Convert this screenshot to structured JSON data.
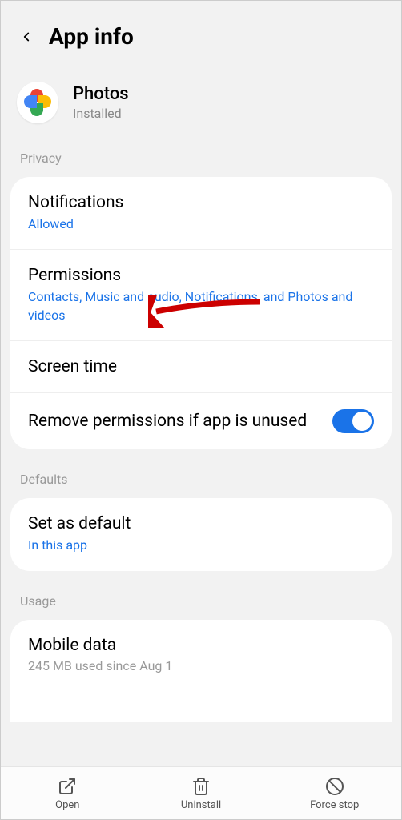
{
  "header": {
    "title": "App info"
  },
  "app": {
    "name": "Photos",
    "status": "Installed"
  },
  "sections": {
    "privacy_label": "Privacy",
    "defaults_label": "Defaults",
    "usage_label": "Usage"
  },
  "privacy": {
    "notifications": {
      "title": "Notifications",
      "sub": "Allowed"
    },
    "permissions": {
      "title": "Permissions",
      "sub": "Contacts, Music and audio, Notifications, and Photos and videos"
    },
    "screen_time": {
      "title": "Screen time"
    },
    "remove_unused": {
      "title": "Remove permissions if app is unused",
      "enabled": true
    }
  },
  "defaults": {
    "set_default": {
      "title": "Set as default",
      "sub": "In this app"
    }
  },
  "usage": {
    "mobile_data": {
      "title": "Mobile data",
      "sub": "245 MB used since Aug 1"
    }
  },
  "bottom": {
    "open": "Open",
    "uninstall": "Uninstall",
    "force_stop": "Force stop"
  }
}
